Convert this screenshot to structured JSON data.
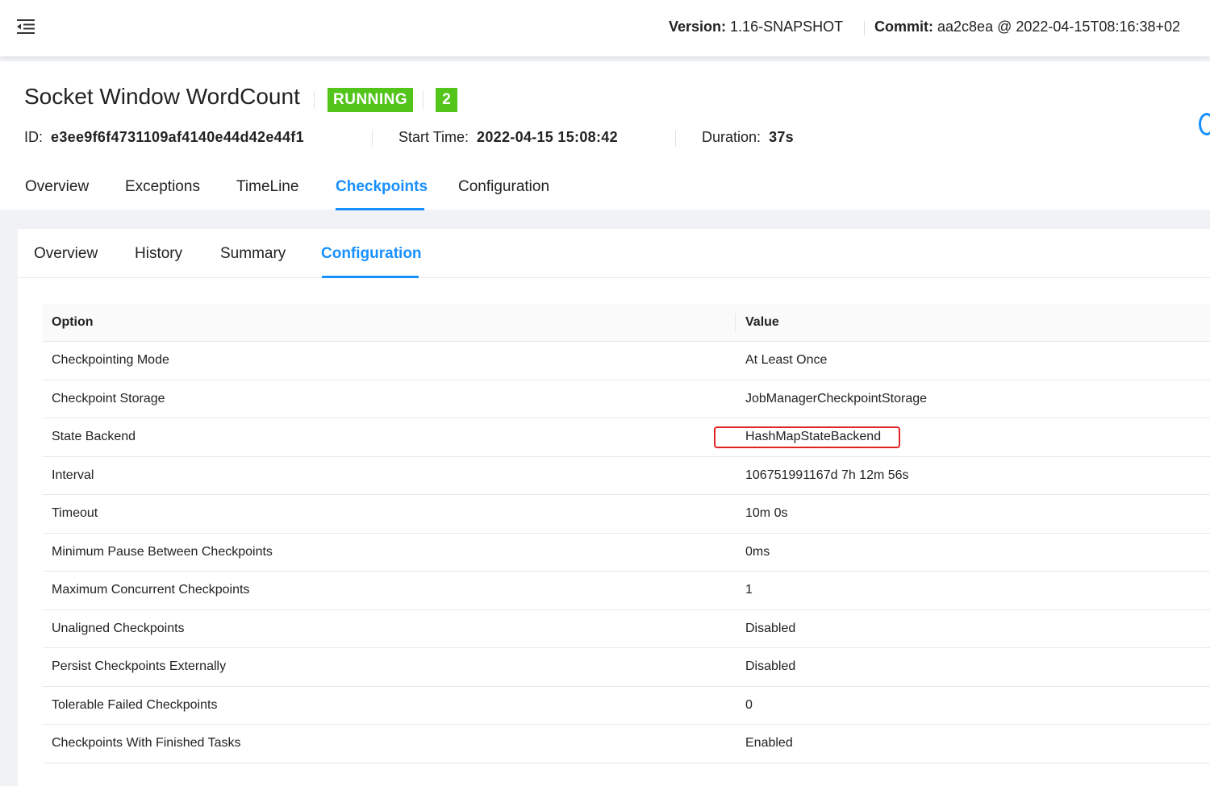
{
  "topbar": {
    "version_label": "Version:",
    "version_value": "1.16-SNAPSHOT",
    "commit_label": "Commit:",
    "commit_value": "aa2c8ea @ 2022-04-15T08:16:38+02"
  },
  "job": {
    "title": "Socket Window WordCount",
    "status": "RUNNING",
    "status_color": "#52c41a",
    "count": "2",
    "id_label": "ID:",
    "id_value": "e3ee9f6f4731109af4140e44d42e44f1",
    "start_label": "Start Time:",
    "start_value": "2022-04-15 15:08:42",
    "duration_label": "Duration:",
    "duration_value": "37s"
  },
  "job_tabs": [
    "Overview",
    "Exceptions",
    "TimeLine",
    "Checkpoints",
    "Configuration"
  ],
  "job_tabs_active": "Checkpoints",
  "checkpoint_tabs": [
    "Overview",
    "History",
    "Summary",
    "Configuration"
  ],
  "checkpoint_tabs_active": "Configuration",
  "accent_color": "#1890ff",
  "highlight_color": "#e32222",
  "table": {
    "headers": [
      "Option",
      "Value"
    ],
    "rows": [
      [
        "Checkpointing Mode",
        "At Least Once"
      ],
      [
        "Checkpoint Storage",
        "JobManagerCheckpointStorage"
      ],
      [
        "State Backend",
        "HashMapStateBackend"
      ],
      [
        "Interval",
        "106751991167d 7h 12m 56s"
      ],
      [
        "Timeout",
        "10m 0s"
      ],
      [
        "Minimum Pause Between Checkpoints",
        "0ms"
      ],
      [
        "Maximum Concurrent Checkpoints",
        "1"
      ],
      [
        "Unaligned Checkpoints",
        "Disabled"
      ],
      [
        "Persist Checkpoints Externally",
        "Disabled"
      ],
      [
        "Tolerable Failed Checkpoints",
        "0"
      ],
      [
        "Checkpoints With Finished Tasks",
        "Enabled"
      ]
    ]
  }
}
